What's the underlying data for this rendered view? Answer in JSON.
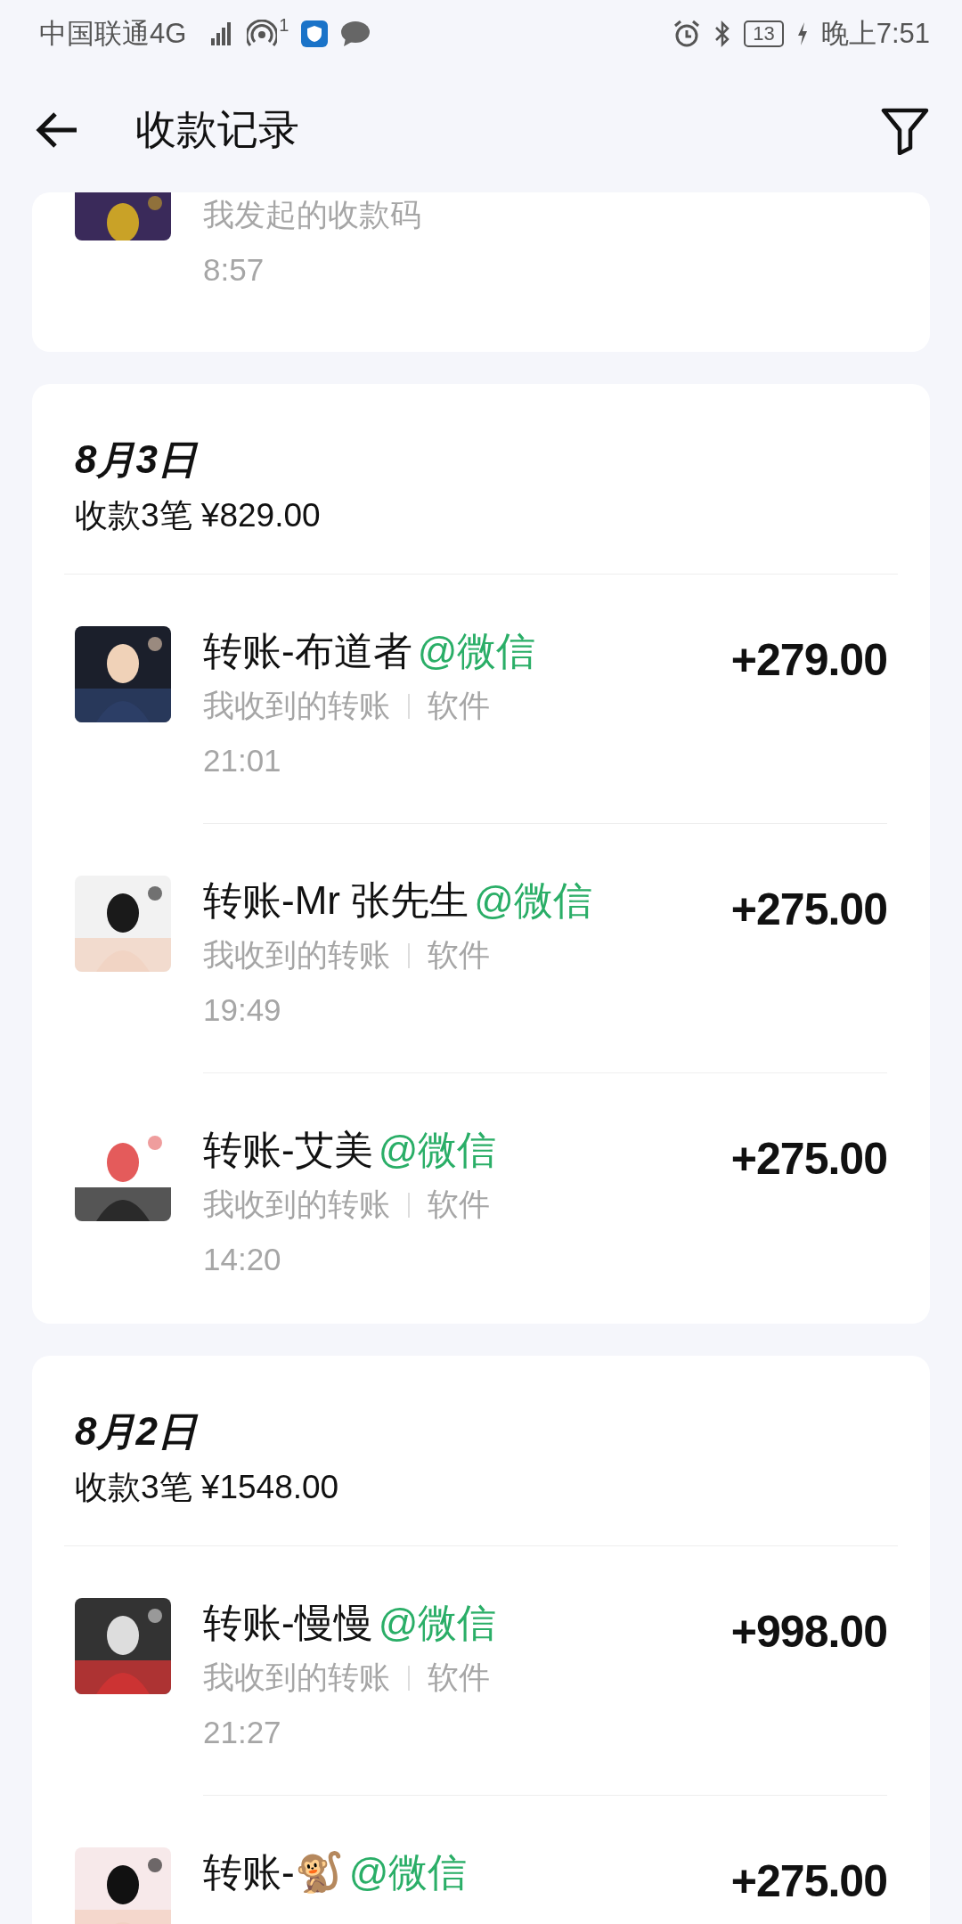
{
  "status_bar": {
    "carrier": "中国联通4G",
    "time": "晚上7:51",
    "battery": "13",
    "hotspot_count": "1"
  },
  "header": {
    "title": "收款记录"
  },
  "groups": [
    {
      "partial": true,
      "items": [
        {
          "subtitle": "我发起的收款码",
          "time": "8:57"
        }
      ]
    },
    {
      "partial": false,
      "date": "8月3日",
      "summary": "收款3笔 ¥829.00",
      "items": [
        {
          "title": "转账-布道者",
          "source": "@微信",
          "subtitle": "我收到的转账",
          "tag": "软件",
          "time": "21:01",
          "amount": "+279.00"
        },
        {
          "title": "转账-Mr 张先生",
          "source": "@微信",
          "subtitle": "我收到的转账",
          "tag": "软件",
          "time": "19:49",
          "amount": "+275.00"
        },
        {
          "title": "转账-艾美",
          "source": "@微信",
          "subtitle": "我收到的转账",
          "tag": "软件",
          "time": "14:20",
          "amount": "+275.00"
        }
      ]
    },
    {
      "partial": false,
      "date": "8月2日",
      "summary": "收款3笔 ¥1548.00",
      "items": [
        {
          "title": "转账-慢慢",
          "source": "@微信",
          "subtitle": "我收到的转账",
          "tag": "软件",
          "time": "21:27",
          "amount": "+998.00"
        },
        {
          "title": "转账-🐒",
          "source": "@微信",
          "amount": "+275.00"
        }
      ]
    }
  ]
}
